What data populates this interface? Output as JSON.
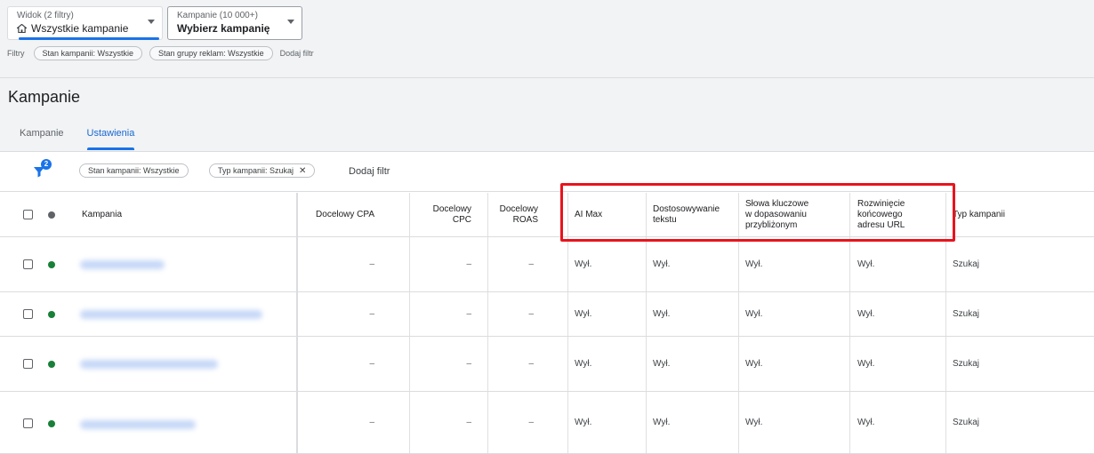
{
  "view_selector": {
    "sub": "Widok (2 filtry)",
    "value": "Wszystkie kampanie"
  },
  "campaign_selector": {
    "sub": "Kampanie (10 000+)",
    "value": "Wybierz kampanię"
  },
  "top_filters": {
    "label": "Filtry",
    "chips": [
      "Stan kampanii: Wszystkie",
      "Stan grupy reklam: Wszystkie"
    ],
    "add": "Dodaj filtr"
  },
  "page_title": "Kampanie",
  "tabs": [
    {
      "label": "Kampanie",
      "active": false
    },
    {
      "label": "Ustawienia",
      "active": true
    }
  ],
  "table_filters": {
    "badge": "2",
    "chips": [
      "Stan kampanii: Wszystkie",
      "Typ kampanii: Szukaj"
    ],
    "add": "Dodaj filtr"
  },
  "columns": {
    "campaign": "Kampania",
    "cpa": "Docelowy CPA",
    "cpc": "Docelowy\nCPC",
    "roas": "Docelowy\nROAS",
    "ai_max": "AI Max",
    "text_custom": "Dostosowywanie\ntekstu",
    "broad_match": "Słowa kluczowe\nw dopasowaniu\nprzybliżonym",
    "url_expansion": "Rozwinięcie\nkońcowego\nadresu URL",
    "type": "Typ kampanii"
  },
  "rows": [
    {
      "cpa": "–",
      "cpc": "–",
      "roas": "–",
      "ai_max": "Wył.",
      "text_custom": "Wył.",
      "broad_match": "Wył.",
      "url_expansion": "Wył.",
      "type": "Szukaj"
    },
    {
      "cpa": "–",
      "cpc": "–",
      "roas": "–",
      "ai_max": "Wył.",
      "text_custom": "Wył.",
      "broad_match": "Wył.",
      "url_expansion": "Wył.",
      "type": "Szukaj"
    },
    {
      "cpa": "–",
      "cpc": "–",
      "roas": "–",
      "ai_max": "Wył.",
      "text_custom": "Wył.",
      "broad_match": "Wył.",
      "url_expansion": "Wył.",
      "type": "Szukaj"
    },
    {
      "cpa": "–",
      "cpc": "–",
      "roas": "–",
      "ai_max": "Wył.",
      "text_custom": "Wył.",
      "broad_match": "Wył.",
      "url_expansion": "Wył.",
      "type": "Szukaj"
    }
  ],
  "colors": {
    "accent": "#1a73e8",
    "status_enabled": "#188038",
    "highlight": "#e8141d"
  }
}
